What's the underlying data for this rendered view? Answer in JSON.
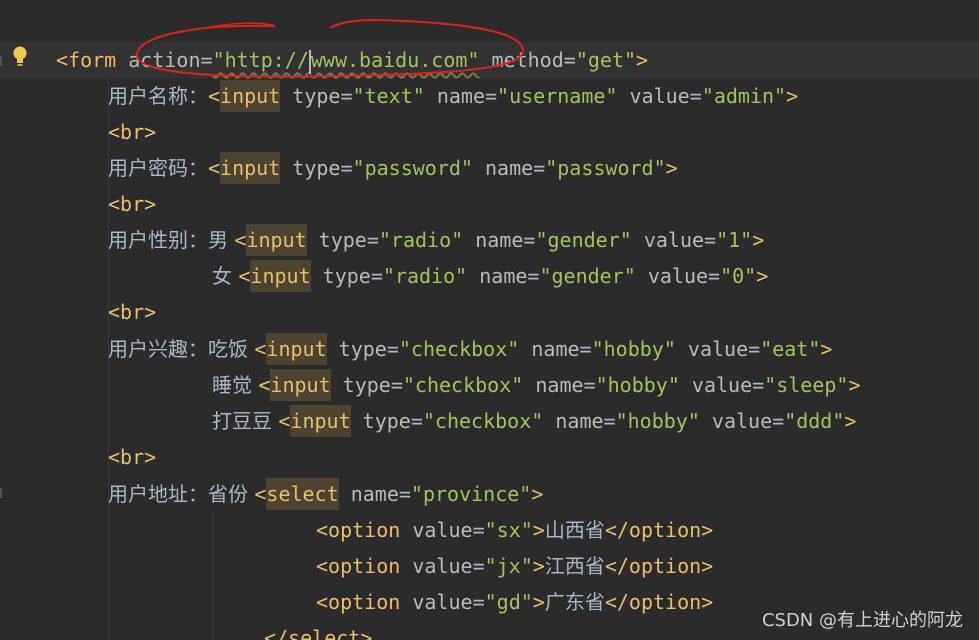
{
  "editor": {
    "lines": {
      "l1": {
        "open": "<form",
        "a1": "action",
        "eq1": "=",
        "v1a": "\"http://",
        "v1b": "www.baidu.com\"",
        "a2": "method",
        "eq2": "=",
        "v2": "\"get\"",
        "close": ">"
      },
      "l2": {
        "label": "用户名称：",
        "open": "<",
        "tag": "input",
        "a1": "type",
        "v1": "\"text\"",
        "a2": "name",
        "v2": "\"username\"",
        "a3": "value",
        "v3": "\"admin\"",
        "close": ">"
      },
      "l3": {
        "br": "<br>"
      },
      "l4": {
        "label": "用户密码：",
        "open": "<",
        "tag": "input",
        "a1": "type",
        "v1": "\"password\"",
        "a2": "name",
        "v2": "\"password\"",
        "close": ">"
      },
      "l5": {
        "br": "<br>"
      },
      "l6": {
        "label": "用户性别：",
        "text": "男 ",
        "open": "<",
        "tag": "input",
        "a1": "type",
        "v1": "\"radio\"",
        "a2": "name",
        "v2": "\"gender\"",
        "a3": "value",
        "v3": "\"1\"",
        "close": ">"
      },
      "l7": {
        "text": "女 ",
        "open": "<",
        "tag": "input",
        "a1": "type",
        "v1": "\"radio\"",
        "a2": "name",
        "v2": "\"gender\"",
        "a3": "value",
        "v3": "\"0\"",
        "close": ">"
      },
      "l8": {
        "br": "<br>"
      },
      "l9": {
        "label": "用户兴趣：",
        "text": "吃饭 ",
        "open": "<",
        "tag": "input",
        "a1": "type",
        "v1": "\"checkbox\"",
        "a2": "name",
        "v2": "\"hobby\"",
        "a3": "value",
        "v3": "\"eat\"",
        "close": ">"
      },
      "l10": {
        "text": "睡觉 ",
        "open": "<",
        "tag": "input",
        "a1": "type",
        "v1": "\"checkbox\"",
        "a2": "name",
        "v2": "\"hobby\"",
        "a3": "value",
        "v3": "\"sleep\"",
        "close": ">"
      },
      "l11": {
        "text": "打豆豆 ",
        "open": "<",
        "tag": "input",
        "a1": "type",
        "v1": "\"checkbox\"",
        "a2": "name",
        "v2": "\"hobby\"",
        "a3": "value",
        "v3": "\"ddd\"",
        "close": ">"
      },
      "l12": {
        "br": "<br>"
      },
      "l13": {
        "label": "用户地址：",
        "text": "省份 ",
        "open": "<",
        "tag": "select",
        "a1": "name",
        "v1": "\"province\"",
        "close": ">"
      },
      "l14": {
        "open": "<option",
        "a1": "value",
        "v1": "\"sx\"",
        "gt": ">",
        "text": "山西省",
        "end": "</option>"
      },
      "l15": {
        "open": "<option",
        "a1": "value",
        "v1": "\"jx\"",
        "gt": ">",
        "text": "江西省",
        "end": "</option>"
      },
      "l16": {
        "open": "<option",
        "a1": "value",
        "v1": "\"gd\"",
        "gt": ">",
        "text": "广东省",
        "end": "</option>"
      },
      "l17": {
        "end": "</select>"
      }
    }
  },
  "watermark": "CSDN @有上进心的阿龙",
  "colors": {
    "background": "#2b2b2b",
    "tag": "#e8bf6a",
    "attribute": "#bababa",
    "string": "#a5c261",
    "annotation": "#e02020"
  }
}
